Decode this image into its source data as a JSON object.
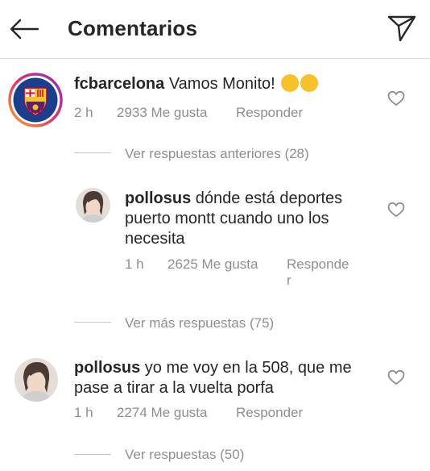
{
  "header": {
    "title": "Comentarios"
  },
  "comments": [
    {
      "username": "fcbarcelona",
      "text": "Vamos Monito!",
      "time": "2 h",
      "likes": "2933 Me gusta",
      "reply": "Responder"
    },
    {
      "username": "pollosus",
      "text_line1": "dónde está deportes",
      "text_line2": "puerto montt cuando uno los",
      "text_line3": "necesita",
      "time": "1 h",
      "likes": "2625 Me gusta",
      "reply_line1": "Responde",
      "reply_line2": "r"
    },
    {
      "username": "pollosus",
      "text_line1": "yo me voy en la 508, que me",
      "text_line2": "pase a tirar a la vuelta porfa",
      "time": "1 h",
      "likes": "2274 Me gusta",
      "reply": "Responder"
    }
  ],
  "view_prev_replies": "Ver respuestas anteriores (28)",
  "view_more_replies": "Ver más respuestas (75)",
  "view_replies": "Ver respuestas (50)",
  "colors": {
    "text": "#262626",
    "secondary": "#8e8e8e",
    "barca_blue": "#1a3f8f",
    "barca_red": "#a50044"
  }
}
